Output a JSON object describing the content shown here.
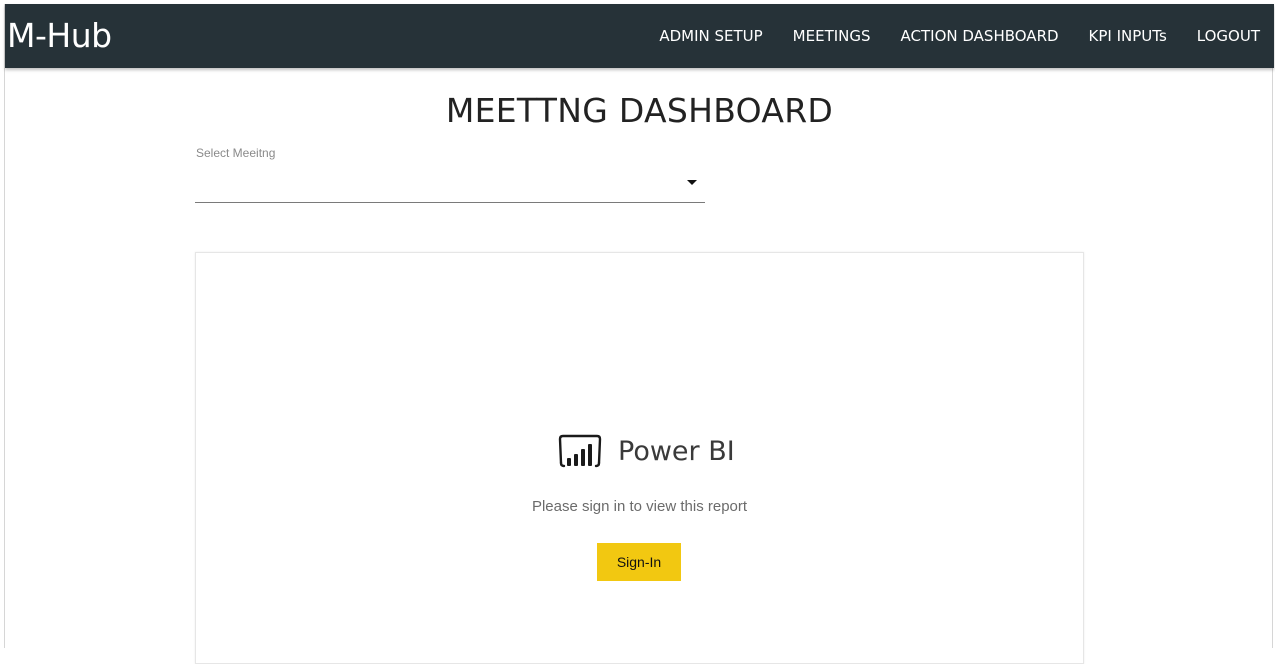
{
  "navbar": {
    "brand": "M-Hub",
    "links": [
      {
        "label": "ADMIN SETUP"
      },
      {
        "label": "MEETINGS"
      },
      {
        "label": "ACTION DASHBOARD"
      },
      {
        "label": "KPI INPUTs"
      },
      {
        "label": "LOGOUT"
      }
    ],
    "background_color": "#263238"
  },
  "main": {
    "title": "MEETTNG DASHBOARD",
    "select": {
      "label": "Select Meeitng",
      "value": ""
    }
  },
  "report": {
    "product_name": "Power BI",
    "message": "Please sign in to view this report",
    "signin_label": "Sign-In",
    "signin_color": "#f2c811",
    "icon": "power-bi-icon"
  }
}
